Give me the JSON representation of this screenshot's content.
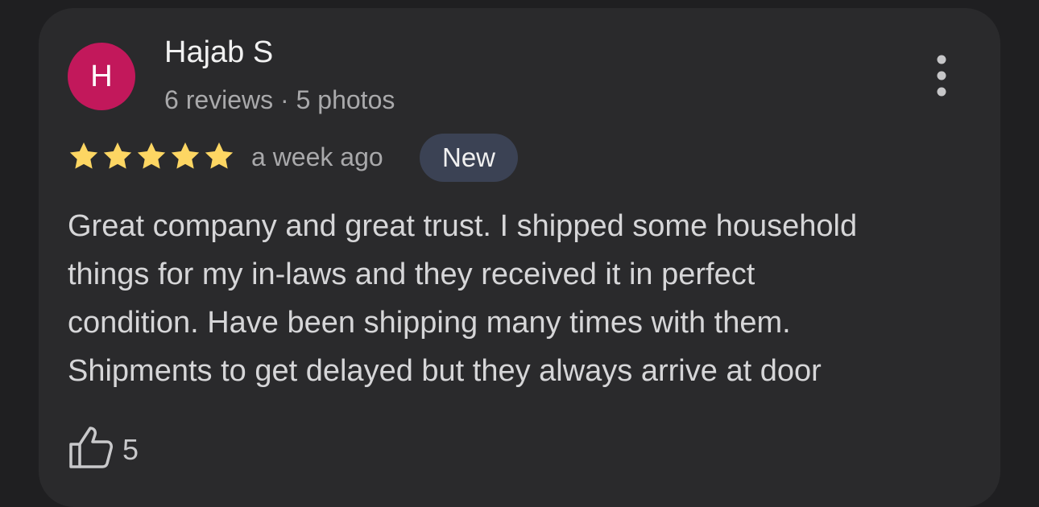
{
  "review": {
    "author": {
      "initial": "H",
      "name": "Hajab S",
      "meta": "6 reviews · 5 photos",
      "avatar_color": "#c2185b"
    },
    "rating": 5,
    "max_rating": 5,
    "time_ago": "a week ago",
    "badge": "New",
    "text_lines": [
      "Great company and great trust. I shipped some household",
      "things for my in-laws and they received it in perfect",
      "condition. Have been shipping many times with them.",
      "Shipments to get delayed but they always arrive at door"
    ],
    "likes": "5"
  },
  "icons": {
    "more": "more-vert-icon",
    "star": "star-icon",
    "like": "thumbs-up-icon"
  },
  "colors": {
    "background": "#1f1f21",
    "card": "#2a2a2c",
    "star": "#fdd663",
    "badge": "#3b4254"
  }
}
